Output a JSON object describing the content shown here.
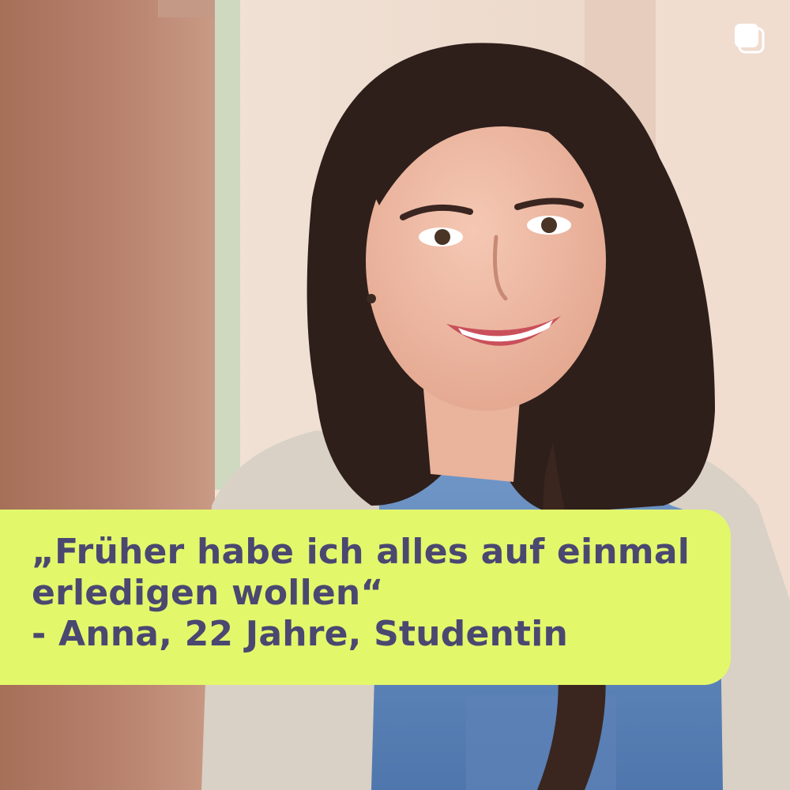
{
  "colors": {
    "quote_box_background": "#e3f76b",
    "quote_text": "#4a4870"
  },
  "icons": {
    "top_right": "multiple-images-icon"
  },
  "quote": {
    "line1": "„Früher habe ich alles auf einmal",
    "line2": "erledigen wollen“",
    "attribution": "- Anna, 22 Jahre, Studentin"
  }
}
